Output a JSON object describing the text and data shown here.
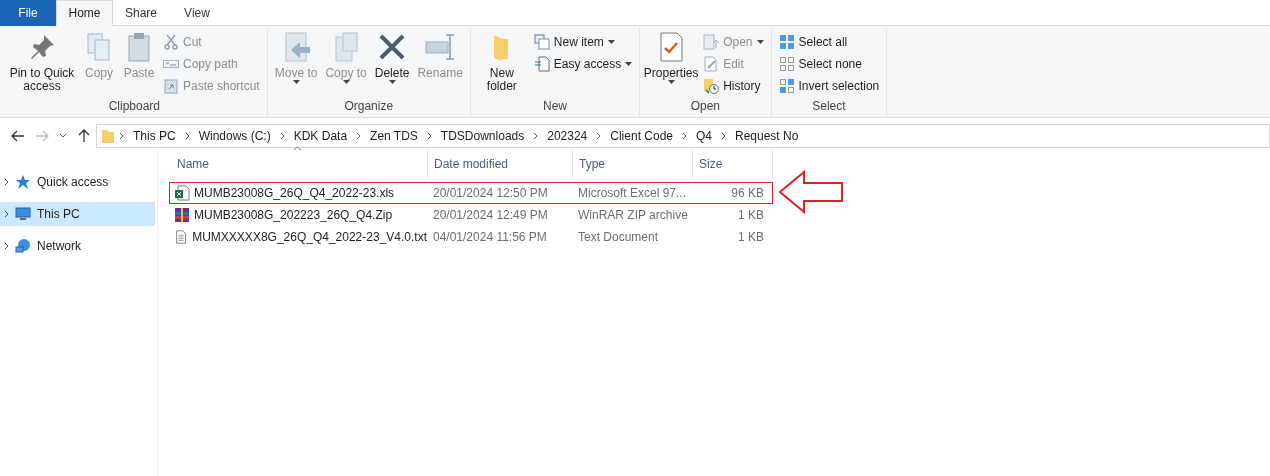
{
  "tabs": [
    {
      "label": "File",
      "kind": "file",
      "selected": false
    },
    {
      "label": "Home",
      "kind": "tab",
      "selected": true
    },
    {
      "label": "Share",
      "kind": "tab",
      "selected": false
    },
    {
      "label": "View",
      "kind": "tab",
      "selected": false
    }
  ],
  "ribbon": {
    "groups": [
      {
        "label": "Clipboard",
        "items": [
          {
            "kind": "large",
            "label": "Pin to Quick access",
            "disabled": false,
            "dropdown": false
          },
          {
            "kind": "large",
            "label": "Copy",
            "disabled": true,
            "dropdown": false
          },
          {
            "kind": "large",
            "label": "Paste",
            "disabled": true,
            "dropdown": false
          },
          {
            "kind": "small",
            "label": "Cut",
            "disabled": true,
            "dropdown": false
          },
          {
            "kind": "small",
            "label": "Copy path",
            "disabled": true,
            "dropdown": false
          },
          {
            "kind": "small",
            "label": "Paste shortcut",
            "disabled": true,
            "dropdown": false
          }
        ]
      },
      {
        "label": "Organize",
        "items": [
          {
            "kind": "large",
            "label": "Move to",
            "disabled": true,
            "dropdown": true
          },
          {
            "kind": "large",
            "label": "Copy to",
            "disabled": true,
            "dropdown": true
          },
          {
            "kind": "large",
            "label": "Delete",
            "disabled": false,
            "dropdown": true
          },
          {
            "kind": "large",
            "label": "Rename",
            "disabled": true,
            "dropdown": false
          }
        ]
      },
      {
        "label": "New",
        "items": [
          {
            "kind": "large",
            "label": "New folder",
            "disabled": false,
            "dropdown": false
          },
          {
            "kind": "small",
            "label": "New item",
            "disabled": false,
            "dropdown": true
          },
          {
            "kind": "small",
            "label": "Easy access",
            "disabled": false,
            "dropdown": true
          }
        ]
      },
      {
        "label": "Open",
        "items": [
          {
            "kind": "large",
            "label": "Properties",
            "disabled": false,
            "dropdown": true
          },
          {
            "kind": "small",
            "label": "Open",
            "disabled": true,
            "dropdown": true
          },
          {
            "kind": "small",
            "label": "Edit",
            "disabled": true,
            "dropdown": false
          },
          {
            "kind": "small",
            "label": "History",
            "disabled": false,
            "dropdown": false
          }
        ]
      },
      {
        "label": "Select",
        "items": [
          {
            "kind": "small",
            "label": "Select all",
            "disabled": false,
            "dropdown": false
          },
          {
            "kind": "small",
            "label": "Select none",
            "disabled": false,
            "dropdown": false
          },
          {
            "kind": "small",
            "label": "Invert selection",
            "disabled": false,
            "dropdown": false
          }
        ]
      }
    ]
  },
  "address_bar": {
    "crumbs": [
      "This PC",
      "Windows (C:)",
      "KDK Data",
      "Zen TDS",
      "TDSDownloads",
      "202324",
      "Client Code",
      "Q4",
      "Request No"
    ]
  },
  "navigation": {
    "items": [
      {
        "label": "Quick access",
        "selected": false
      },
      {
        "label": "This PC",
        "selected": true
      },
      {
        "label": "Network",
        "selected": false
      }
    ]
  },
  "table": {
    "columns": [
      "Name",
      "Date modified",
      "Type",
      "Size"
    ],
    "rows": [
      {
        "kind": "excel",
        "name": "MUMB23008G_26Q_Q4_2022-23.xls",
        "date": "20/01/2024 12:50 PM",
        "type": "Microsoft Excel 97...",
        "size": "96 KB",
        "highlighted": true
      },
      {
        "kind": "archive",
        "name": "MUMB23008G_202223_26Q_Q4.Zip",
        "date": "20/01/2024 12:49 PM",
        "type": "WinRAR ZIP archive",
        "size": "1 KB",
        "highlighted": false
      },
      {
        "kind": "text",
        "name": "MUMXXXXX8G_26Q_Q4_2022-23_V4.0.txt",
        "date": "04/01/2024 11:56 PM",
        "type": "Text Document",
        "size": "1 KB",
        "highlighted": false
      }
    ]
  }
}
